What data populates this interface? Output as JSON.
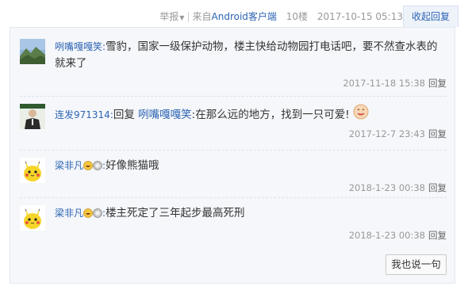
{
  "post_meta": {
    "report_label": "举报",
    "source_prefix": "来自",
    "source_link": "Android客户端",
    "floor": "10楼",
    "date": "2017-10-15 05:13",
    "collapse_label": "收起回复"
  },
  "replies": [
    {
      "user": "咧嘴嘎嘎笑",
      "separator": ":",
      "text": "雪豹，国家一级保护动物，楼主快给动物园打电话吧，要不然查水表的就来了",
      "time": "2017-11-18 15:38",
      "reply_label": "回复"
    },
    {
      "user": "连发971314",
      "separator": ":",
      "reply_prefix": "回复 ",
      "reply_to": "咧嘴嘎嘎笑",
      "text": ":在那么远的地方，找到一只可爱!",
      "time": "2017-12-7 23:43",
      "reply_label": "回复"
    },
    {
      "user": "梁非凡",
      "separator": ":",
      "text": "好像熊猫哦",
      "time": "2018-1-23 00:38",
      "reply_label": "回复"
    },
    {
      "user": "梁非凡",
      "separator": ":",
      "text": "楼主死定了三年起步最高死刑",
      "time": "2018-1-23 00:38",
      "reply_label": "回复"
    }
  ],
  "actions": {
    "say_label": "我也说一句"
  }
}
